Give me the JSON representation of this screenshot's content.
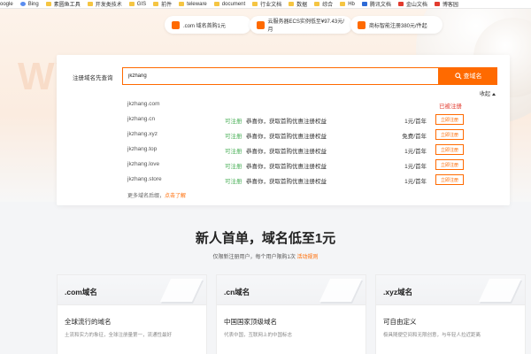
{
  "bookmarks": [
    {
      "label": "oogle",
      "icon": "google-icon"
    },
    {
      "label": "Bing",
      "icon": "bing-icon"
    },
    {
      "label": "素圆鱼工具",
      "icon": "folder-icon"
    },
    {
      "label": "开发类技术",
      "icon": "folder-icon"
    },
    {
      "label": "GIS",
      "icon": "folder-icon"
    },
    {
      "label": "前件",
      "icon": "folder-icon"
    },
    {
      "label": "teleware",
      "icon": "folder-icon"
    },
    {
      "label": "document",
      "icon": "folder-icon"
    },
    {
      "label": "行业文档",
      "icon": "folder-icon"
    },
    {
      "label": "数据",
      "icon": "folder-icon"
    },
    {
      "label": "综合",
      "icon": "folder-icon"
    },
    {
      "label": "Hb",
      "icon": "hb-icon"
    },
    {
      "label": "腾讯文档",
      "icon": "tencent-docs-icon"
    },
    {
      "label": "金山文档",
      "icon": "kingsoft-docs-icon"
    },
    {
      "label": "博客园",
      "icon": "cnblogs-icon"
    }
  ],
  "promos": [
    ".com 域名首购1元",
    "云服务器ECS实例低至¥97.43元/月",
    "商标智能注册380元/件起"
  ],
  "hero_watermark": "WW",
  "search": {
    "label": "注册域名先查询",
    "value": "jkzhang",
    "button": "查域名",
    "collapse": "收起"
  },
  "results": [
    {
      "domain": "jkzhang.com",
      "status": "",
      "desc": "",
      "price": "",
      "taken": "已被注册",
      "button": ""
    },
    {
      "domain": "jkzhang.cn",
      "status": "可注册",
      "desc": "恭喜你，获取首购优惠注册权益",
      "price": "1元/首年",
      "taken": "",
      "button": "立即注册"
    },
    {
      "domain": "jkzhang.xyz",
      "status": "可注册",
      "desc": "恭喜你，获取首购优惠注册权益",
      "price": "免费/首年",
      "taken": "",
      "button": "立即注册"
    },
    {
      "domain": "jkzhang.top",
      "status": "可注册",
      "desc": "恭喜你，获取首购优惠注册权益",
      "price": "1元/首年",
      "taken": "",
      "button": "立即注册"
    },
    {
      "domain": "jkzhang.love",
      "status": "可注册",
      "desc": "恭喜你，获取首购优惠注册权益",
      "price": "1元/首年",
      "taken": "",
      "button": "立即注册"
    },
    {
      "domain": "jkzhang.store",
      "status": "可注册",
      "desc": "恭喜你，获取首购优惠注册权益",
      "price": "1元/首年",
      "taken": "",
      "button": "立即注册"
    }
  ],
  "more": {
    "text": "更多域名后缀，",
    "link": "点击了解"
  },
  "headline": "新人首单，域名低至1元",
  "subline": {
    "text": "仅限新注册用户，每个用户限购1次",
    "link": "活动规则"
  },
  "cards": [
    {
      "title": ".com域名",
      "subtitle": "全球流行的域名",
      "desc": "土流和实力的象征，全球注册量第一，流通性最好"
    },
    {
      "title": ".cn域名",
      "subtitle": "中国国家顶级域名",
      "desc": "代表中国，互联网上的中国标志"
    },
    {
      "title": ".xyz域名",
      "subtitle": "可自由定义",
      "desc": "极具随便空间和无限创意，与年轻人拉近距离"
    }
  ],
  "colors": {
    "accent": "#ff6a00",
    "available": "#4cb05a",
    "taken": "#e23b2e"
  }
}
